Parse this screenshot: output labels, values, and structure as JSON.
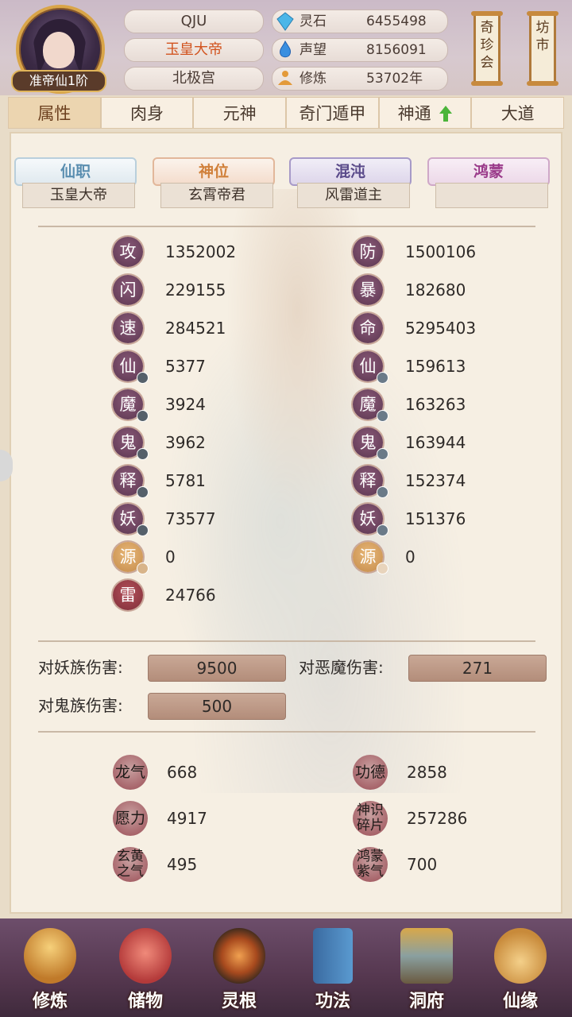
{
  "header": {
    "avatar_rank": "准帝仙1阶",
    "player_name": "QJU",
    "title": "玉皇大帝",
    "palace": "北极宫",
    "resources": [
      {
        "label": "灵石",
        "value": "6455498",
        "icon": "crystal-icon"
      },
      {
        "label": "声望",
        "value": "8156091",
        "icon": "flame-icon"
      },
      {
        "label": "修炼",
        "value": "53702年",
        "icon": "meditation-icon"
      }
    ],
    "buttons": [
      {
        "label": "奇珍会"
      },
      {
        "label": "坊市"
      }
    ]
  },
  "tabs": [
    {
      "label": "属性",
      "active": true
    },
    {
      "label": "肉身"
    },
    {
      "label": "元神"
    },
    {
      "label": "奇门遁甲"
    },
    {
      "label": "神通",
      "has_upgrade_arrow": true
    },
    {
      "label": "大道"
    }
  ],
  "titles": [
    {
      "category": "仙职",
      "value": "玉皇大帝",
      "color": "#5a8eb0"
    },
    {
      "category": "神位",
      "value": "玄霄帝君",
      "color": "#d0803a"
    },
    {
      "category": "混沌",
      "value": "风雷道主",
      "color": "#5a4a8a"
    },
    {
      "category": "鸿蒙",
      "value": "",
      "color": "#9a3a8a"
    }
  ],
  "stats_left": [
    {
      "label": "攻",
      "value": "1352002"
    },
    {
      "label": "闪",
      "value": "229155"
    },
    {
      "label": "速",
      "value": "284521"
    },
    {
      "label": "仙",
      "value": "5377"
    },
    {
      "label": "魔",
      "value": "3924"
    },
    {
      "label": "鬼",
      "value": "3962"
    },
    {
      "label": "释",
      "value": "5781"
    },
    {
      "label": "妖",
      "value": "73577"
    },
    {
      "label": "源",
      "value": "0"
    },
    {
      "label": "雷",
      "value": "24766"
    }
  ],
  "stats_right": [
    {
      "label": "防",
      "value": "1500106"
    },
    {
      "label": "暴",
      "value": "182680"
    },
    {
      "label": "命",
      "value": "5295403"
    },
    {
      "label": "仙",
      "value": "159613"
    },
    {
      "label": "魔",
      "value": "163263"
    },
    {
      "label": "鬼",
      "value": "163944"
    },
    {
      "label": "释",
      "value": "152374"
    },
    {
      "label": "妖",
      "value": "151376"
    },
    {
      "label": "源",
      "value": "0"
    }
  ],
  "damage": [
    {
      "label": "对妖族伤害:",
      "value": "9500"
    },
    {
      "label": "对恶魔伤害:",
      "value": "271"
    },
    {
      "label": "对鬼族伤害:",
      "value": "500"
    }
  ],
  "misc_left": [
    {
      "label": "龙气",
      "value": "668"
    },
    {
      "label": "愿力",
      "value": "4917"
    },
    {
      "label": "玄黄之气",
      "value": "495"
    }
  ],
  "misc_right": [
    {
      "label": "功德",
      "value": "2858"
    },
    {
      "label": "神识碎片",
      "value": "257286"
    },
    {
      "label": "鸿蒙紫气",
      "value": "700"
    }
  ],
  "bottom_nav": [
    {
      "label": "修炼",
      "icon": "cultivate-icon",
      "color": "#e0a040"
    },
    {
      "label": "储物",
      "icon": "bag-icon",
      "color": "#d85a50"
    },
    {
      "label": "灵根",
      "icon": "spirit-root-icon",
      "color": "#d06a30"
    },
    {
      "label": "功法",
      "icon": "book-icon",
      "color": "#3a7ab0"
    },
    {
      "label": "洞府",
      "icon": "cave-house-icon",
      "color": "#c89a50"
    },
    {
      "label": "仙缘",
      "icon": "gourd-icon",
      "color": "#e0b070"
    }
  ]
}
